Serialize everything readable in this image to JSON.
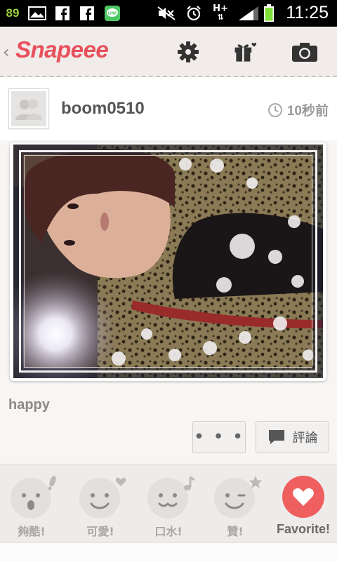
{
  "status_bar": {
    "battery_level": "89",
    "network": "H+",
    "time": "11:25",
    "colors": {
      "battery_text": "#9ccf3c",
      "battery_fill": "#7ee038"
    },
    "icons": [
      "image-icon",
      "facebook-icon",
      "facebook-icon",
      "line-icon",
      "mute-icon",
      "alarm-icon",
      "signal-icon",
      "battery-icon"
    ]
  },
  "app_bar": {
    "logo": "Snapeee",
    "brand_color": "#e8505b",
    "icons": [
      "back-chevron-icon",
      "gear-icon",
      "gift-icon",
      "camera-icon"
    ]
  },
  "post": {
    "username": "boom0510",
    "time_ago": "10秒前",
    "caption": "happy"
  },
  "actions": {
    "more_label": "• • •",
    "comment_label": "評論"
  },
  "reactions": [
    {
      "label": "夠酷!",
      "icon": "cool-face-icon"
    },
    {
      "label": "可愛!",
      "icon": "cute-face-icon"
    },
    {
      "label": "口水!",
      "icon": "drool-face-icon"
    },
    {
      "label": "贊!",
      "icon": "praise-face-icon"
    },
    {
      "label": "Favorite!",
      "icon": "heart-icon",
      "color": "#ef5f5f"
    }
  ]
}
